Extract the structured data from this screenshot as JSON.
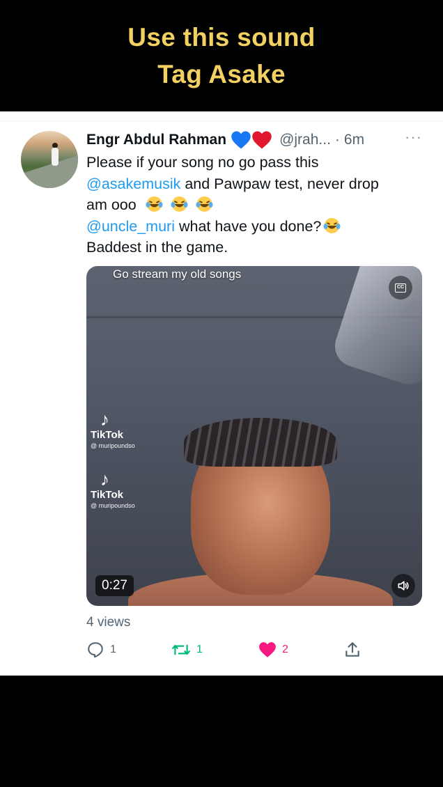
{
  "banner": {
    "line1": "Use this sound",
    "line2": "Tag Asake"
  },
  "tweet": {
    "author_name": "Engr Abdul Rahman",
    "handle": "@jrah...",
    "separator": "·",
    "time": "6m",
    "more": "···",
    "text": {
      "line1": "Please if your song no go pass this",
      "line2_mention": "@asakemusik",
      "line2_rest": " and Pawpaw test, never drop",
      "line3": "am ooo",
      "line4_mention": "@uncle_muri",
      "line4_rest": " what have you done?",
      "line5": "Baddest in the game."
    },
    "media": {
      "caption": "Go stream my old songs",
      "watermark_brand": "TikTok",
      "watermark_user": "@ muripoundso",
      "duration": "0:27",
      "cc_label": "CC"
    },
    "views": "4 views",
    "actions": {
      "reply_count": "1",
      "retweet_count": "1",
      "like_count": "2"
    }
  },
  "icons": {
    "hearts": [
      "blue-heart-icon",
      "red-heart-icon"
    ],
    "reply": "reply-icon",
    "retweet": "retweet-icon",
    "like": "like-icon",
    "share": "share-icon",
    "sound": "speaker-icon",
    "captions": "closed-caption-icon"
  },
  "colors": {
    "banner_text": "#f2d062",
    "mention": "#1d9bf0",
    "retweet": "#00ba7c",
    "like": "#f91880",
    "secondary": "#536471"
  }
}
